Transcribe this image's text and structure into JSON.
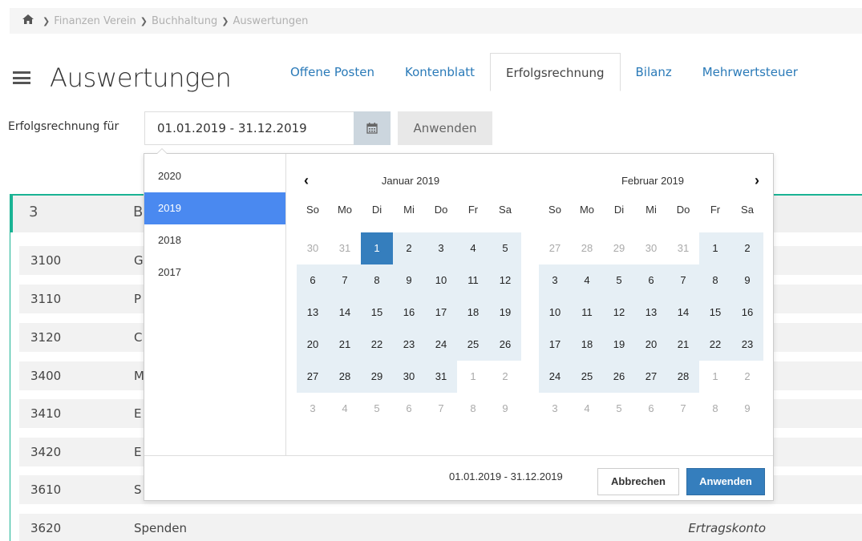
{
  "breadcrumb": {
    "items": [
      "Finanzen Verein",
      "Buchhaltung",
      "Auswertungen"
    ],
    "home_icon": "home-icon",
    "separator_icon": "chevron-right-icon"
  },
  "header": {
    "title": "Auswertungen",
    "menu_icon": "hamburger-menu-icon"
  },
  "tabs": [
    {
      "label": "Offene Posten",
      "active": false
    },
    {
      "label": "Kontenblatt",
      "active": false
    },
    {
      "label": "Erfolgsrechnung",
      "active": true
    },
    {
      "label": "Bilanz",
      "active": false
    },
    {
      "label": "Mehrwertsteuer",
      "active": false
    }
  ],
  "filter": {
    "label": "Erfolgsrechnung für",
    "date_value": "01.01.2019 - 31.12.2019",
    "calendar_icon": "calendar-icon",
    "apply_label": "Anwenden"
  },
  "section": {
    "number": "3",
    "name_partial": "B"
  },
  "rows": [
    {
      "code": "3100",
      "label": "G",
      "type": ""
    },
    {
      "code": "3110",
      "label": "P",
      "type": ""
    },
    {
      "code": "3120",
      "label": "C",
      "type": ""
    },
    {
      "code": "3400",
      "label": "M",
      "type": ""
    },
    {
      "code": "3410",
      "label": "E",
      "type": ""
    },
    {
      "code": "3420",
      "label": "E",
      "type": ""
    },
    {
      "code": "3610",
      "label": "S",
      "type": ""
    },
    {
      "code": "3620",
      "label": "Spenden",
      "type": "Ertragskonto"
    }
  ],
  "picker": {
    "ranges": [
      {
        "label": "2020",
        "active": false
      },
      {
        "label": "2019",
        "active": true
      },
      {
        "label": "2018",
        "active": false
      },
      {
        "label": "2017",
        "active": false
      }
    ],
    "weekdays": [
      "So",
      "Mo",
      "Di",
      "Mi",
      "Do",
      "Fr",
      "Sa"
    ],
    "months": [
      {
        "title": "Januar 2019",
        "nav": "prev",
        "days": [
          [
            "30",
            "off"
          ],
          [
            "31",
            "off"
          ],
          [
            "1",
            "start"
          ],
          [
            "2",
            "in"
          ],
          [
            "3",
            "in"
          ],
          [
            "4",
            "in"
          ],
          [
            "5",
            "in"
          ],
          [
            "6",
            "in"
          ],
          [
            "7",
            "in"
          ],
          [
            "8",
            "in"
          ],
          [
            "9",
            "in"
          ],
          [
            "10",
            "in"
          ],
          [
            "11",
            "in"
          ],
          [
            "12",
            "in"
          ],
          [
            "13",
            "in"
          ],
          [
            "14",
            "in"
          ],
          [
            "15",
            "in"
          ],
          [
            "16",
            "in"
          ],
          [
            "17",
            "in"
          ],
          [
            "18",
            "in"
          ],
          [
            "19",
            "in"
          ],
          [
            "20",
            "in"
          ],
          [
            "21",
            "in"
          ],
          [
            "22",
            "in"
          ],
          [
            "23",
            "in"
          ],
          [
            "24",
            "in"
          ],
          [
            "25",
            "in"
          ],
          [
            "26",
            "in"
          ],
          [
            "27",
            "in"
          ],
          [
            "28",
            "in"
          ],
          [
            "29",
            "in"
          ],
          [
            "30",
            "in"
          ],
          [
            "31",
            "in"
          ],
          [
            "1",
            "off"
          ],
          [
            "2",
            "off"
          ],
          [
            "3",
            "off"
          ],
          [
            "4",
            "off"
          ],
          [
            "5",
            "off"
          ],
          [
            "6",
            "off"
          ],
          [
            "7",
            "off"
          ],
          [
            "8",
            "off"
          ],
          [
            "9",
            "off"
          ]
        ]
      },
      {
        "title": "Februar 2019",
        "nav": "next",
        "days": [
          [
            "27",
            "off"
          ],
          [
            "28",
            "off"
          ],
          [
            "29",
            "off"
          ],
          [
            "30",
            "off"
          ],
          [
            "31",
            "off"
          ],
          [
            "1",
            "in"
          ],
          [
            "2",
            "in"
          ],
          [
            "3",
            "in"
          ],
          [
            "4",
            "in"
          ],
          [
            "5",
            "in"
          ],
          [
            "6",
            "in"
          ],
          [
            "7",
            "in"
          ],
          [
            "8",
            "in"
          ],
          [
            "9",
            "in"
          ],
          [
            "10",
            "in"
          ],
          [
            "11",
            "in"
          ],
          [
            "12",
            "in"
          ],
          [
            "13",
            "in"
          ],
          [
            "14",
            "in"
          ],
          [
            "15",
            "in"
          ],
          [
            "16",
            "in"
          ],
          [
            "17",
            "in"
          ],
          [
            "18",
            "in"
          ],
          [
            "19",
            "in"
          ],
          [
            "20",
            "in"
          ],
          [
            "21",
            "in"
          ],
          [
            "22",
            "in"
          ],
          [
            "23",
            "in"
          ],
          [
            "24",
            "in"
          ],
          [
            "25",
            "in"
          ],
          [
            "26",
            "in"
          ],
          [
            "27",
            "in"
          ],
          [
            "28",
            "in"
          ],
          [
            "1",
            "off"
          ],
          [
            "2",
            "off"
          ],
          [
            "3",
            "off"
          ],
          [
            "4",
            "off"
          ],
          [
            "5",
            "off"
          ],
          [
            "6",
            "off"
          ],
          [
            "7",
            "off"
          ],
          [
            "8",
            "off"
          ],
          [
            "9",
            "off"
          ]
        ]
      }
    ],
    "nav_prev_icon": "chevron-left-icon",
    "nav_next_icon": "chevron-right-icon",
    "selected_range": "01.01.2019 - 31.12.2019",
    "cancel_label": "Abbrechen",
    "apply_label": "Anwenden"
  },
  "colors": {
    "accent": "#1ab394",
    "link": "#2a7ab8",
    "primary_button": "#357ebd",
    "range_active": "#4a89f0",
    "in_range": "#e6eff5"
  }
}
